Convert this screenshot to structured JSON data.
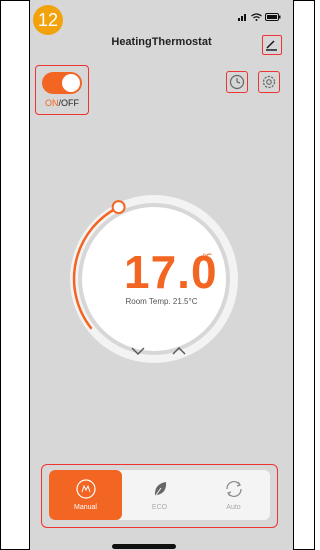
{
  "step_badge": "12",
  "header": {
    "title": "HeatingThermostat"
  },
  "power": {
    "on_label": "ON",
    "separator": "/",
    "off_label": "OFF",
    "state": "on"
  },
  "thermostat": {
    "set_temp": "17.0",
    "unit": "℃",
    "room_temp_text": "Room Temp. 21.5°C",
    "accent": "#f26522"
  },
  "modes": [
    {
      "label": "Manual",
      "icon": "hand-icon",
      "active": true
    },
    {
      "label": "ECO",
      "icon": "leaf-icon",
      "active": false
    },
    {
      "label": "Auto",
      "icon": "auto-cycle-icon",
      "active": false
    }
  ],
  "colors": {
    "accent": "#f26522",
    "annotation": "#e33333",
    "badge": "#f2a20d"
  }
}
